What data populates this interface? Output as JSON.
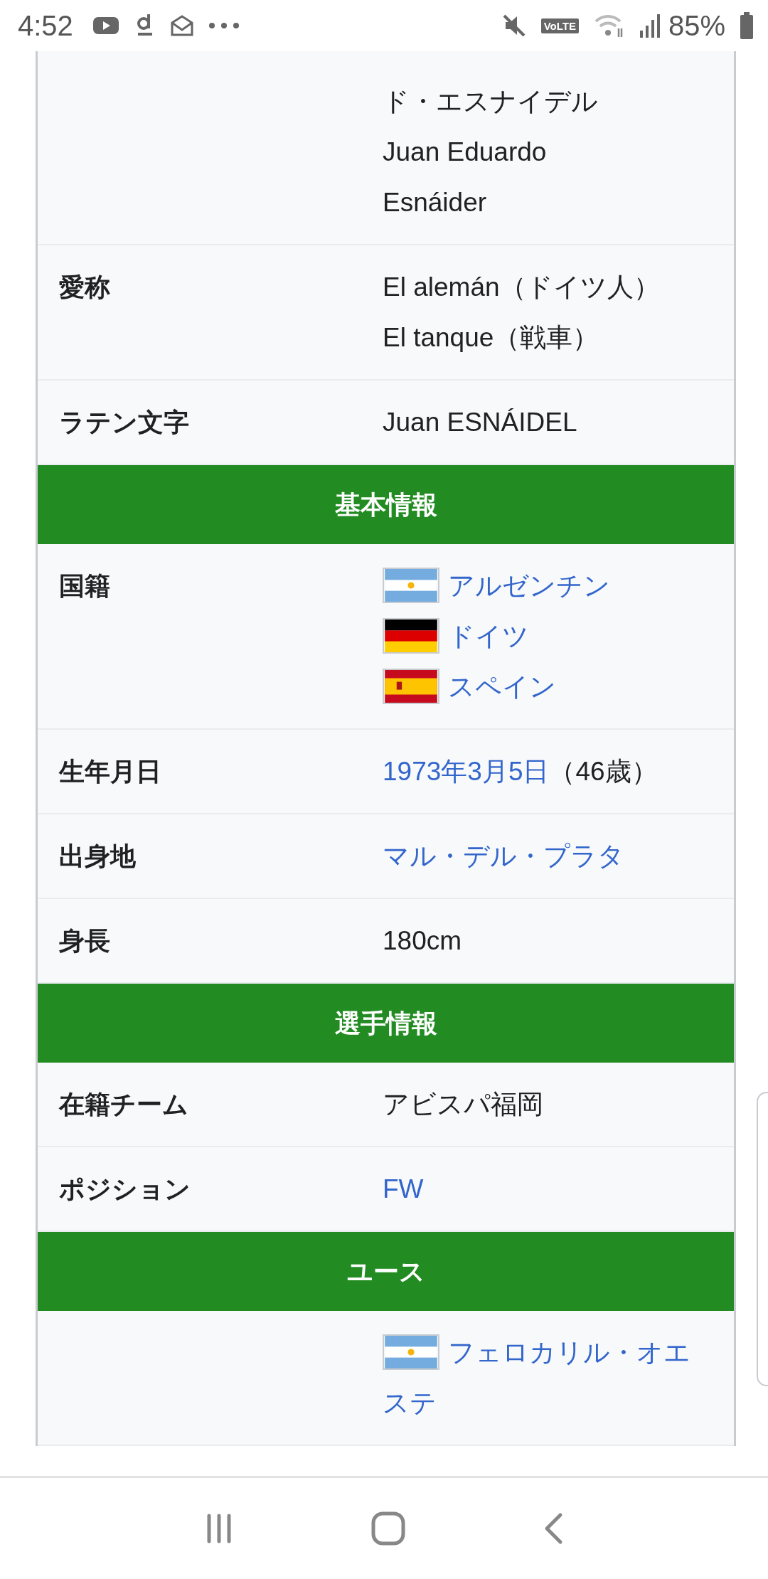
{
  "status_bar": {
    "time": "4:52",
    "volte": "VoLTE",
    "battery": "85%"
  },
  "infobox": {
    "rows": [
      {
        "kind": "field",
        "lines": [
          {
            "parts": [
              {
                "text": "ド・エスナイデル",
                "link": false
              }
            ]
          },
          {
            "parts": [
              {
                "text": "Juan Eduardo",
                "link": false
              }
            ]
          },
          {
            "parts": [
              {
                "text": "Esnáider",
                "link": false
              }
            ]
          }
        ]
      },
      {
        "kind": "field",
        "label": "愛称",
        "lines": [
          {
            "parts": [
              {
                "text": "El alemán（ドイツ人）",
                "link": false
              }
            ]
          },
          {
            "parts": [
              {
                "text": "El tanque（戦車）",
                "link": false
              }
            ]
          }
        ]
      },
      {
        "kind": "field",
        "label": "ラテン文字",
        "lines": [
          {
            "parts": [
              {
                "text": "Juan ESNÁIDEL",
                "link": false
              }
            ]
          }
        ]
      },
      {
        "kind": "header",
        "label": "基本情報"
      },
      {
        "kind": "field",
        "label": "国籍",
        "lines": [
          {
            "kind": "argentina",
            "parts": [
              {
                "text": "アルゼンチン",
                "link": true
              }
            ]
          },
          {
            "kind": "germany",
            "parts": [
              {
                "text": "ドイツ",
                "link": true
              }
            ]
          },
          {
            "kind": "spain",
            "parts": [
              {
                "text": "スペイン",
                "link": true
              }
            ]
          }
        ]
      },
      {
        "kind": "field",
        "label": "生年月日",
        "lines": [
          {
            "parts": [
              {
                "text": "1973年3月5日",
                "link": true
              },
              {
                "text": "（46歳）",
                "link": false
              }
            ]
          }
        ]
      },
      {
        "kind": "field",
        "label": "出身地",
        "lines": [
          {
            "parts": [
              {
                "text": "マル・デル・プラタ",
                "link": true
              }
            ]
          }
        ]
      },
      {
        "kind": "field",
        "label": "身長",
        "lines": [
          {
            "parts": [
              {
                "text": "180cm",
                "link": false
              }
            ]
          }
        ]
      },
      {
        "kind": "header",
        "label": "選手情報"
      },
      {
        "kind": "field",
        "label": "在籍チーム",
        "lines": [
          {
            "parts": [
              {
                "text": "アビスパ福岡",
                "link": false
              }
            ]
          }
        ]
      },
      {
        "kind": "field",
        "label": "ポジション",
        "lines": [
          {
            "parts": [
              {
                "text": "FW",
                "link": true
              }
            ]
          }
        ]
      },
      {
        "kind": "header",
        "label": "ユース"
      },
      {
        "kind": "field",
        "lines": [
          {
            "kind": "argentina",
            "parts": [
              {
                "text": "フェロカリル・オエステ",
                "link": true
              }
            ]
          }
        ]
      }
    ]
  }
}
